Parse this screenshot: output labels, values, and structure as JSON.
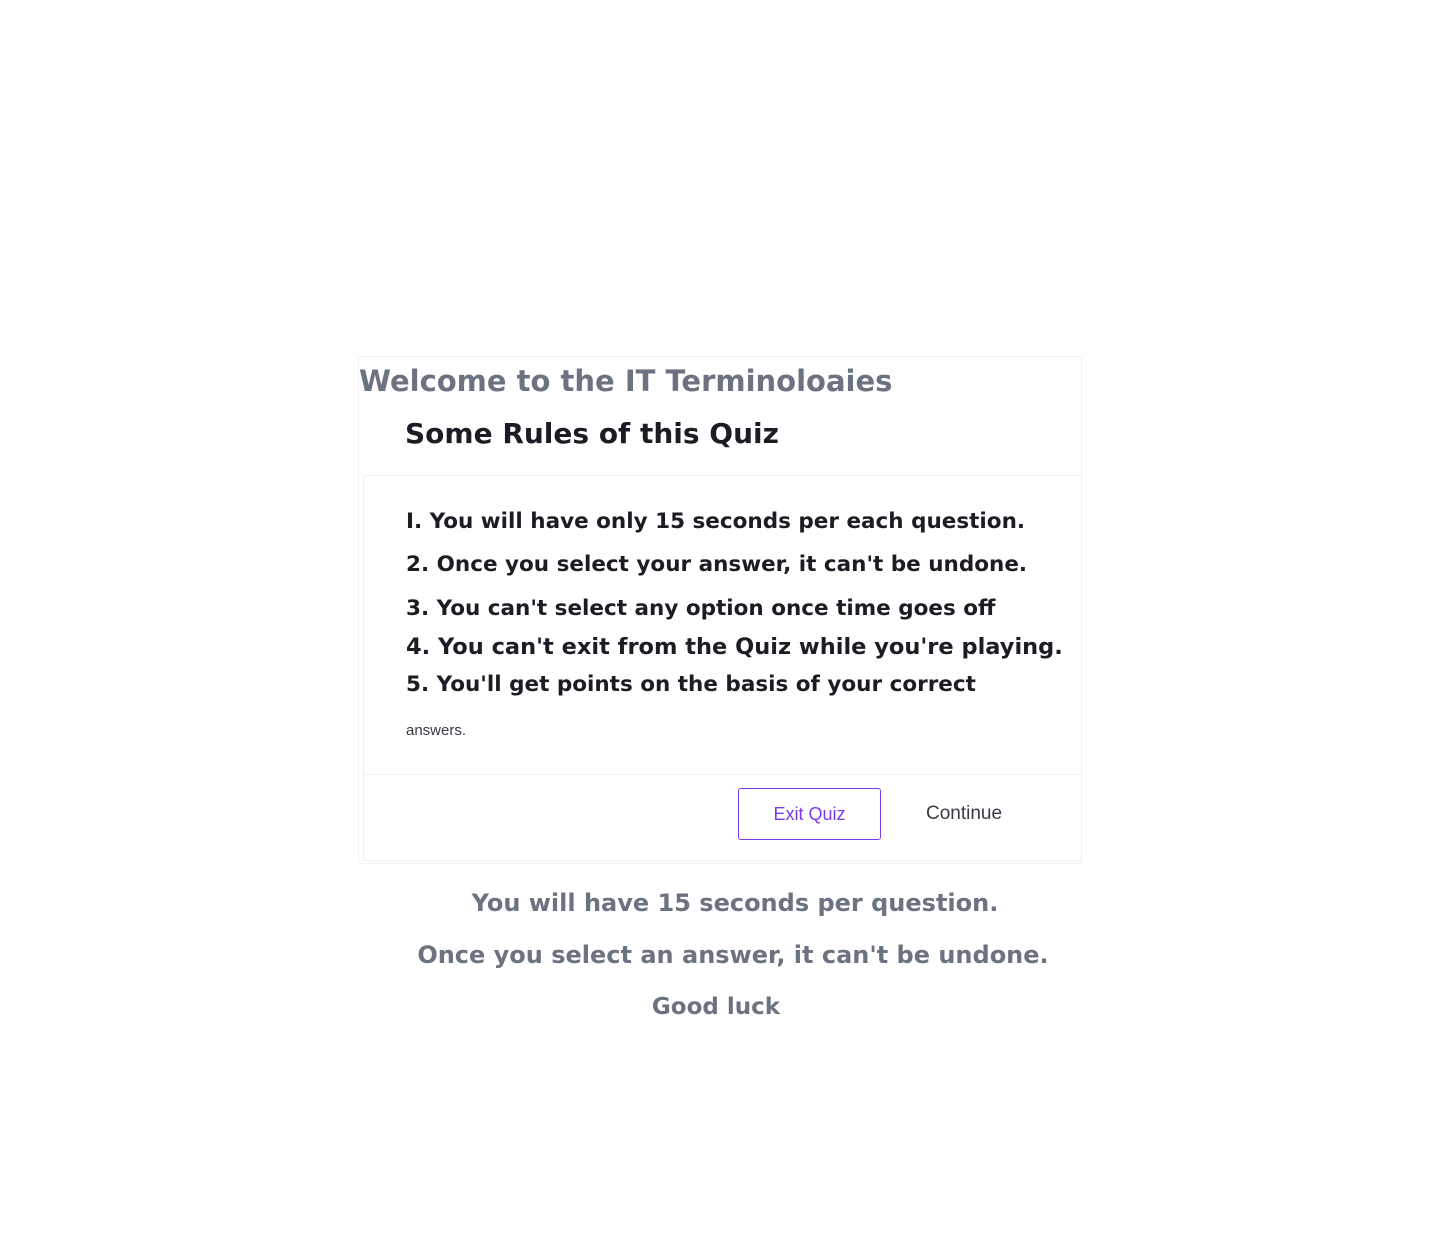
{
  "card": {
    "welcome_title": "Welcome to the IT Terminoloaies",
    "rules_title": "Some Rules of this Quiz",
    "rules": [
      "I. You will have only 15 seconds per each question.",
      "2. Once you select your answer, it can't be undone.",
      "3. You can't select any option once time goes off",
      "4. You can't exit from the Quiz while you're playing.",
      "5. You'll get points on the basis of your correct"
    ],
    "rule_continuation": "answers.",
    "exit_label": "Exit Quiz",
    "continue_label": "Continue"
  },
  "info": {
    "line1": "You will have 15 seconds per question.",
    "line2": "Once you select an answer, it can't be undone.",
    "line3": "Good luck"
  },
  "colors": {
    "accent": "#7c3aed",
    "heading_gray": "#6b7280",
    "text_dark": "#1c1d24"
  }
}
